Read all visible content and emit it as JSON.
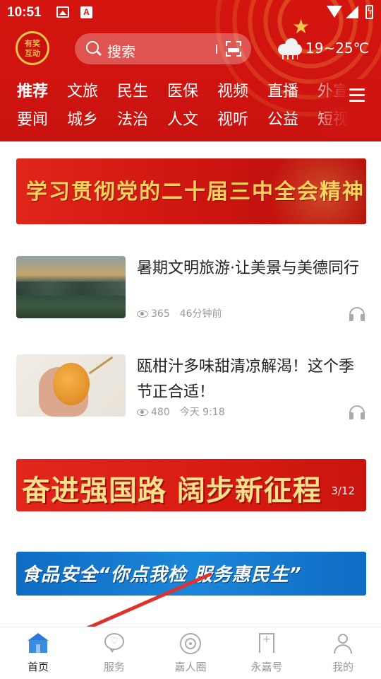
{
  "status_bar": {
    "time": "10:51"
  },
  "header": {
    "badge_lines": [
      "有奖",
      "互动"
    ],
    "search": {
      "placeholder": "搜索"
    },
    "weather": {
      "temperature": "19~25℃",
      "icon": "cloud-rain-icon"
    }
  },
  "channels": {
    "row1": [
      "推荐",
      "文旅",
      "民生",
      "医保",
      "视频",
      "直播",
      "外宣"
    ],
    "row2": [
      "要闻",
      "城乡",
      "法治",
      "人文",
      "视听",
      "公益",
      "短视"
    ],
    "active": "推荐"
  },
  "banners": {
    "top": {
      "text": "学习贯彻党的二十届三中全会精神"
    },
    "middle": {
      "text": "奋进强国路 阔步新征程",
      "counter": "3/12"
    },
    "bottom": {
      "text": "食品安全“你点我检 服务惠民生”"
    }
  },
  "news": [
    {
      "title": "暑期文明旅游·让美景与美德同行",
      "views": "365",
      "time": "46分钟前"
    },
    {
      "title": "瓯柑汁多味甜清凉解渴！这个季节正合适！",
      "views": "480",
      "time": "今天 9:18"
    }
  ],
  "bottom_nav": {
    "items": [
      {
        "label": "首页",
        "icon": "home-icon"
      },
      {
        "label": "服务",
        "icon": "service-icon"
      },
      {
        "label": "嘉人圈",
        "icon": "circle-icon"
      },
      {
        "label": "永嘉号",
        "icon": "bookmark-icon"
      },
      {
        "label": "我的",
        "icon": "me-icon"
      }
    ],
    "active": "首页"
  },
  "colors": {
    "header_red": "#cf1410",
    "accent_gold": "#f4c24a",
    "banner_blue": "#0e6cc4",
    "active_home": "#3b8be0",
    "annotation_arrow": "#e0322a"
  }
}
